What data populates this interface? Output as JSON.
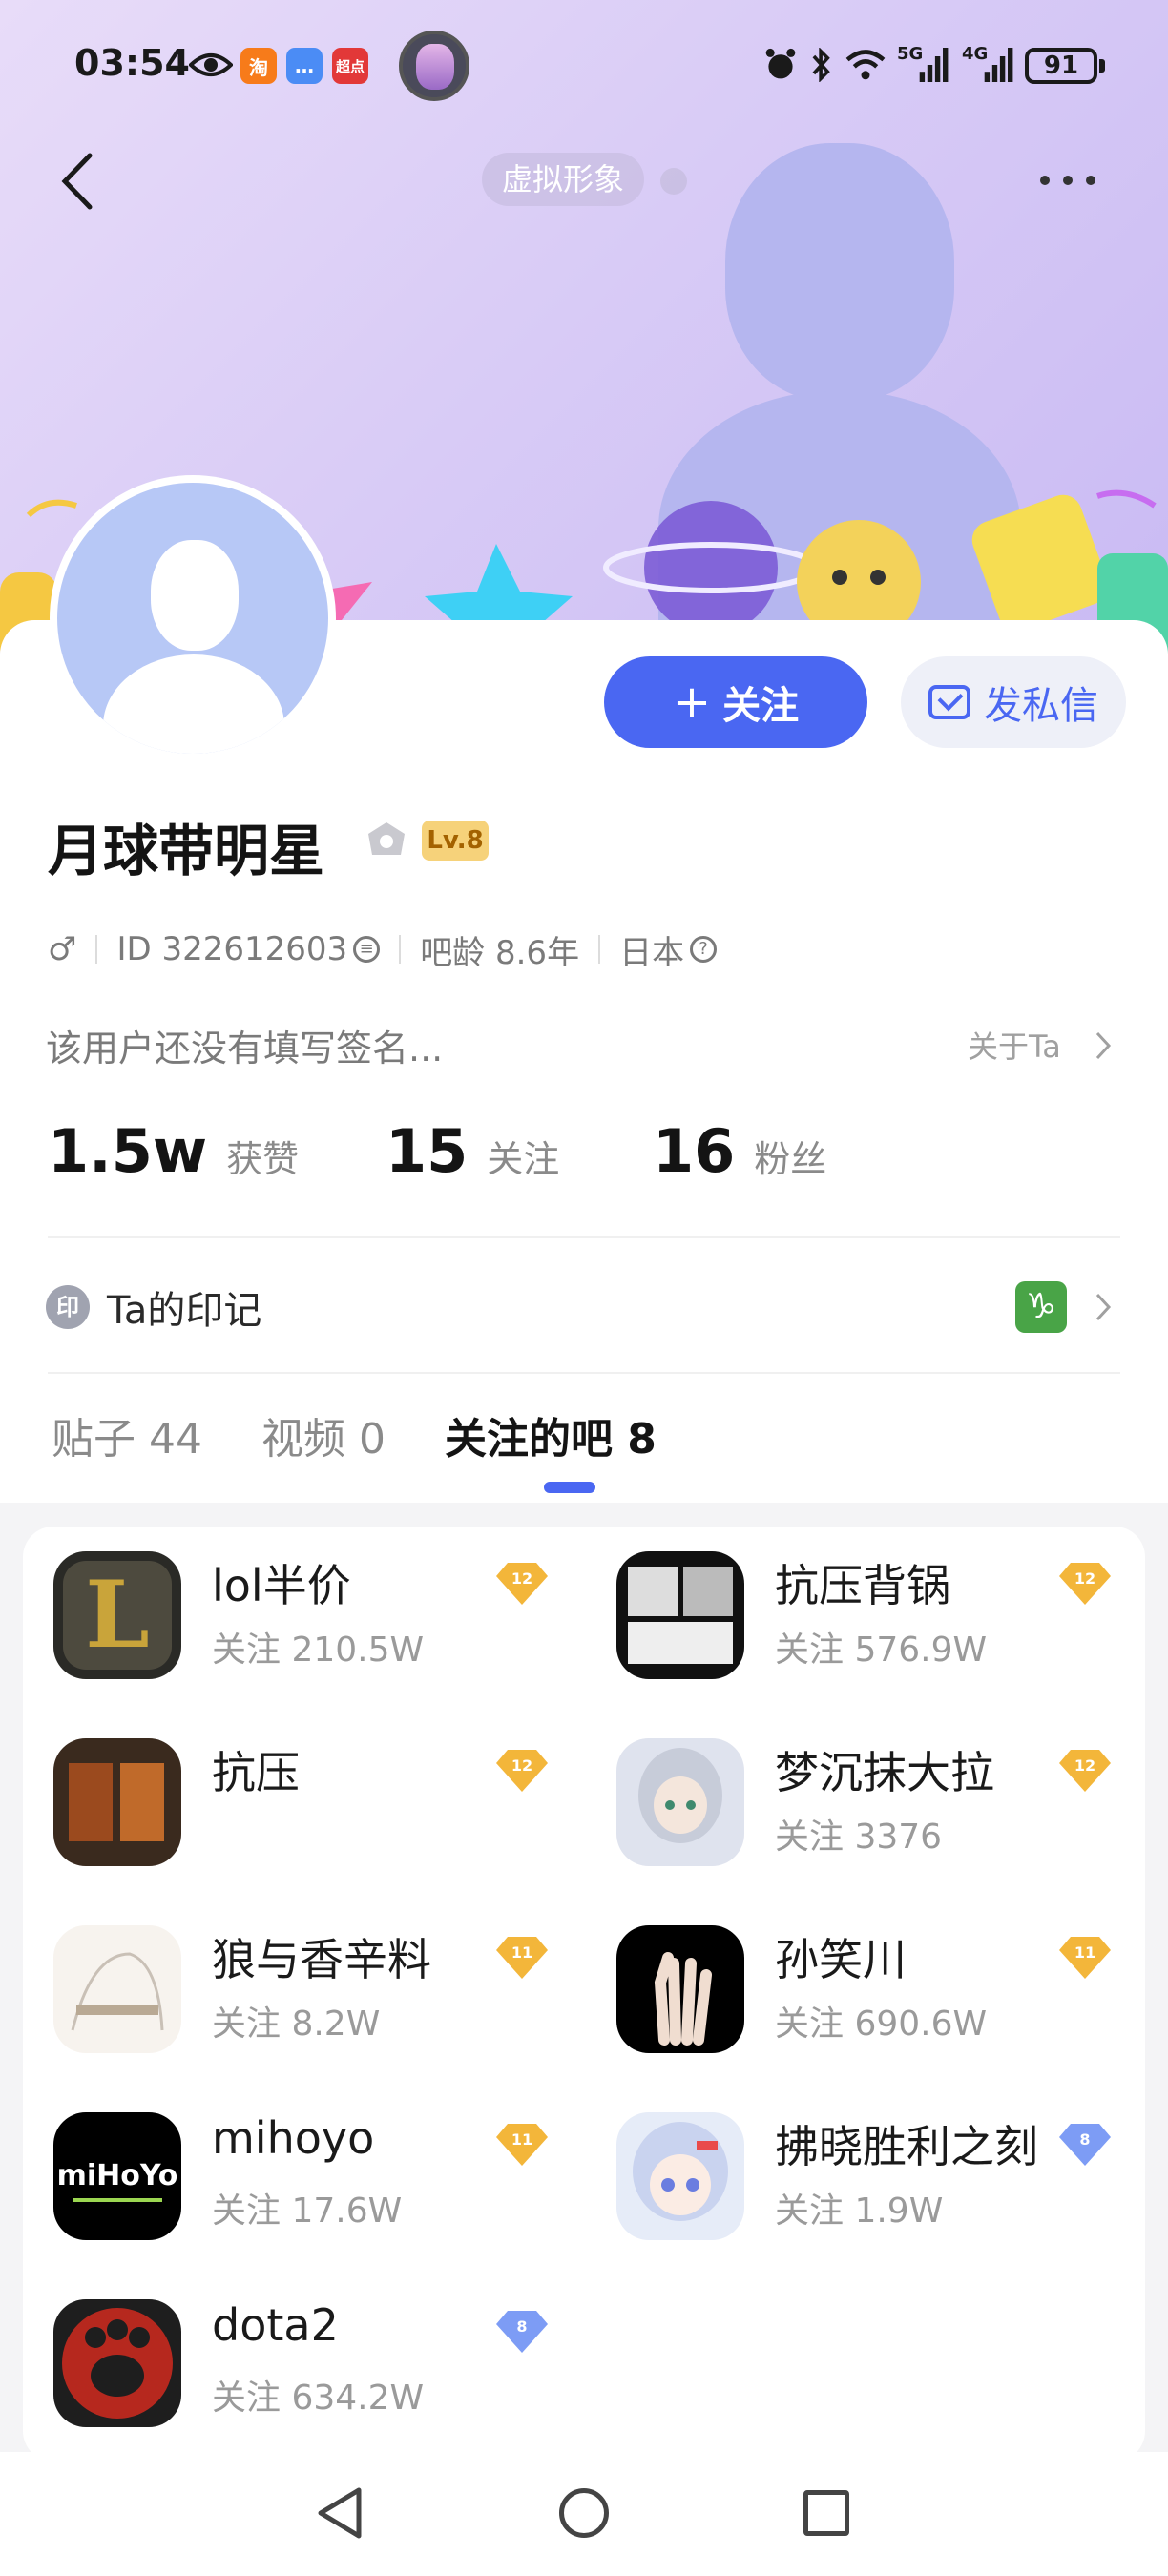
{
  "status_bar": {
    "time": "03:54",
    "app_icons": [
      "淘",
      "超点"
    ],
    "network": [
      "5G",
      "4G"
    ],
    "battery": "91"
  },
  "header": {
    "virtual_label": "虚拟形象"
  },
  "profile": {
    "username": "月球带明星",
    "level": "Lv.8",
    "gender_symbol": "♂",
    "id_text": "ID 322612603",
    "age_text": "吧龄 8.6年",
    "location_text": "日本",
    "signature": "该用户还没有填写签名...",
    "about_label": "关于Ta"
  },
  "actions": {
    "follow_label": "关注",
    "follow_plus": "+",
    "message_label": "发私信"
  },
  "stats": [
    {
      "value": "1.5w",
      "label": "获赞"
    },
    {
      "value": "15",
      "label": "关注"
    },
    {
      "value": "16",
      "label": "粉丝"
    }
  ],
  "mark": {
    "icon_text": "印",
    "label": "Ta的印记",
    "zodiac_symbol": "♑"
  },
  "tabs": [
    {
      "label": "贴子 44",
      "active": false
    },
    {
      "label": "视频 0",
      "active": false
    },
    {
      "label": "关注的吧 8",
      "active": true
    }
  ],
  "bars": [
    {
      "name": "lol半价",
      "count": "关注 210.5W",
      "level": "12",
      "level_color": "#f3b63a"
    },
    {
      "name": "抗压背锅",
      "count": "关注 576.9W",
      "level": "12",
      "level_color": "#f3b63a"
    },
    {
      "name": "抗压",
      "count": "",
      "level": "12",
      "level_color": "#f3b63a"
    },
    {
      "name": "梦沉抹大拉",
      "count": "关注 3376",
      "level": "12",
      "level_color": "#f3b63a"
    },
    {
      "name": "狼与香辛料",
      "count": "关注 8.2W",
      "level": "11",
      "level_color": "#f3b63a"
    },
    {
      "name": "孙笑川",
      "count": "关注 690.6W",
      "level": "11",
      "level_color": "#f3b63a"
    },
    {
      "name": "mihoyo",
      "count": "关注 17.6W",
      "level": "11",
      "level_color": "#f3b63a"
    },
    {
      "name": "拂晓胜利之刻",
      "count": "关注 1.9W",
      "level": "8",
      "level_color": "#7d9cf5"
    },
    {
      "name": "dota2",
      "count": "关注 634.2W",
      "level": "8",
      "level_color": "#7d9cf5"
    }
  ],
  "thumb_texts": {
    "lol": "L",
    "mihoyo": "miHoYo"
  }
}
